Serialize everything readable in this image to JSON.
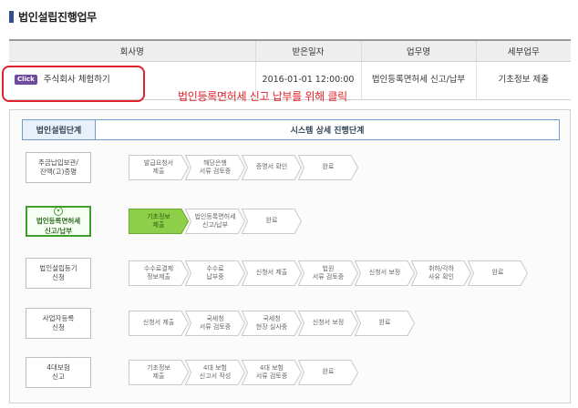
{
  "page_title": "법인설립진행업무",
  "summary_table": {
    "headers": [
      "회사명",
      "받은일자",
      "업무명",
      "세부업무"
    ],
    "row": {
      "badge": "Click",
      "company": "주식회사 체험하기",
      "received_date": "2016-01-01 12:00:00",
      "task": "법인등록면허세 신고/납부",
      "detail": "기초정보 제출"
    }
  },
  "hint": "법인등록면허세 신고 납부를 위해 클릭",
  "panel": {
    "header_left": "법인설립단계",
    "header_right": "시스템 상세 진행단계",
    "stages": [
      {
        "label": "주금납입보관/\n잔액(고)증명",
        "active": false,
        "steps": [
          {
            "label": "발급요청서\n제출",
            "active": false
          },
          {
            "label": "해당은행\n서류 검토중",
            "active": false
          },
          {
            "label": "증명서 확인",
            "active": false
          },
          {
            "label": "완료",
            "active": false
          }
        ]
      },
      {
        "label": "법인등록면허세\n신고/납부",
        "active": true,
        "steps": [
          {
            "label": "기초정보\n제출",
            "active": true
          },
          {
            "label": "법인등록면허세\n신고/납부",
            "active": false
          },
          {
            "label": "완료",
            "active": false
          }
        ]
      },
      {
        "label": "법인설립등기\n신청",
        "active": false,
        "steps": [
          {
            "label": "수수료결제\n정보제출",
            "active": false
          },
          {
            "label": "수수료\n납부중",
            "active": false
          },
          {
            "label": "신청서 제출",
            "active": false
          },
          {
            "label": "법원\n서류 검토중",
            "active": false
          },
          {
            "label": "신청서 보정",
            "active": false
          },
          {
            "label": "취하/각하\n사유 확인",
            "active": false
          },
          {
            "label": "완료",
            "active": false
          }
        ]
      },
      {
        "label": "사업자등록\n신청",
        "active": false,
        "steps": [
          {
            "label": "신청서 제출",
            "active": false
          },
          {
            "label": "국세청\n서류 검토중",
            "active": false
          },
          {
            "label": "국세청\n현장 실사중",
            "active": false
          },
          {
            "label": "신청서 보정",
            "active": false
          },
          {
            "label": "완료",
            "active": false
          }
        ]
      },
      {
        "label": "4대보험\n신고",
        "active": false,
        "steps": [
          {
            "label": "기초정보\n제출",
            "active": false
          },
          {
            "label": "4대 보험\n신고서 작성",
            "active": false
          },
          {
            "label": "4대 보험\n서류 검토중",
            "active": false
          },
          {
            "label": "완료",
            "active": false
          }
        ]
      }
    ]
  },
  "colors": {
    "highlight": "#e2222a",
    "active_stage": "#3f9f2b",
    "active_step": "#8ecf4a",
    "header_border": "#6f9ccd",
    "badge": "#6d4c9f"
  }
}
